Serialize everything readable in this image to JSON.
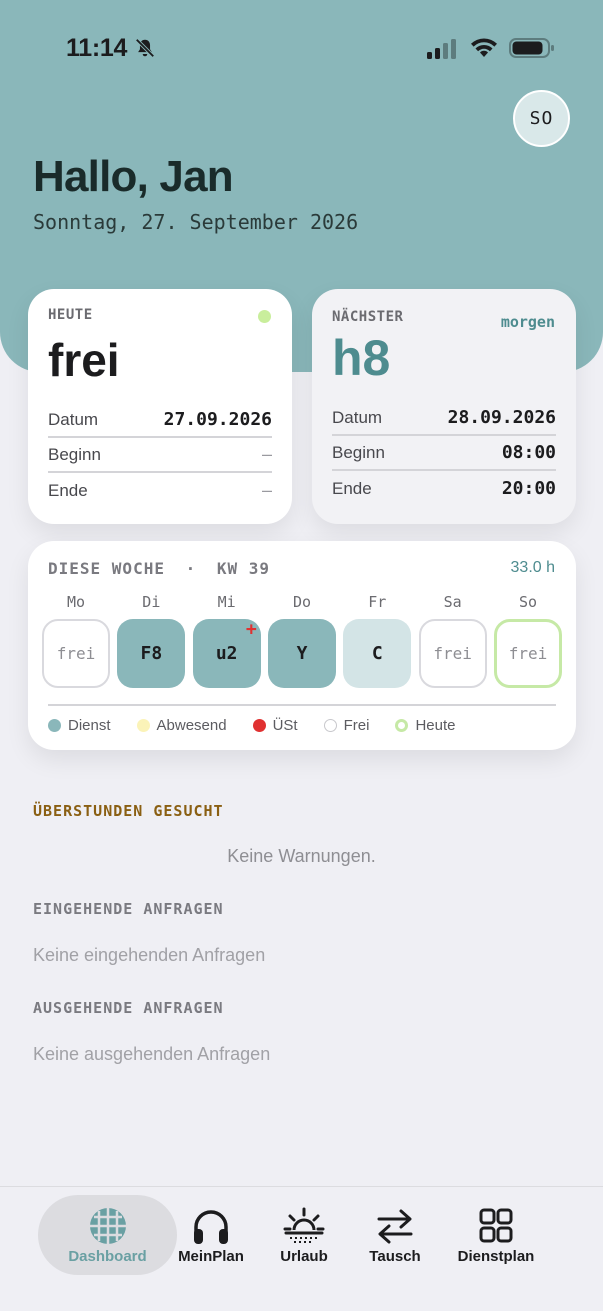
{
  "status_bar": {
    "time": "11:14",
    "icons": [
      "bell-slash-icon",
      "cellular-signal-icon",
      "wifi-icon",
      "battery-icon"
    ]
  },
  "header": {
    "avatar_initials": "SO",
    "greeting": "Hallo, Jan",
    "date": "Sonntag, 27. September 2026"
  },
  "today_card": {
    "label": "HEUTE",
    "value": "frei",
    "rows": [
      {
        "label": "Datum",
        "value": "27.09.2026"
      },
      {
        "label": "Beginn",
        "value": "–"
      },
      {
        "label": "Ende",
        "value": "–"
      }
    ]
  },
  "next_card": {
    "label": "NÄCHSTER",
    "when": "morgen",
    "value": "h8",
    "rows": [
      {
        "label": "Datum",
        "value": "28.09.2026"
      },
      {
        "label": "Beginn",
        "value": "08:00"
      },
      {
        "label": "Ende",
        "value": "20:00"
      }
    ]
  },
  "week": {
    "title": "DIESE WOCHE",
    "separator": "·",
    "kw": "KW 39",
    "hours": "33.0 h",
    "days": [
      {
        "label": "Mo",
        "value": "frei",
        "type": "frei"
      },
      {
        "label": "Di",
        "value": "F8",
        "type": "dienst"
      },
      {
        "label": "Mi",
        "value": "u2",
        "type": "dienst",
        "overtime": "+"
      },
      {
        "label": "Do",
        "value": "Y",
        "type": "dienst"
      },
      {
        "label": "Fr",
        "value": "C",
        "type": "light"
      },
      {
        "label": "Sa",
        "value": "frei",
        "type": "frei"
      },
      {
        "label": "So",
        "value": "frei",
        "type": "heute"
      }
    ],
    "legend": [
      {
        "label": "Dienst",
        "color": "#8ab7ba"
      },
      {
        "label": "Abwesend",
        "color": "#fbf3b8"
      },
      {
        "label": "ÜSt",
        "color": "#e03131"
      },
      {
        "label": "Frei",
        "color": "#ffffff"
      },
      {
        "label": "Heute",
        "color": "#c6e9a6"
      }
    ]
  },
  "sections": {
    "overtime_title": "ÜBERSTUNDEN GESUCHT",
    "overtime_empty": "Keine Warnungen.",
    "incoming_title": "EINGEHENDE ANFRAGEN",
    "incoming_empty": "Keine eingehenden Anfragen",
    "outgoing_title": "AUSGEHENDE ANFRAGEN",
    "outgoing_empty": "Keine ausgehenden Anfragen"
  },
  "tabbar": {
    "tabs": [
      {
        "label": "Dashboard",
        "icon": "globe-grid-icon",
        "active": true
      },
      {
        "label": "MeinPlan",
        "icon": "headphones-icon"
      },
      {
        "label": "Urlaub",
        "icon": "sunrise-icon"
      },
      {
        "label": "Tausch",
        "icon": "swap-arrows-icon"
      },
      {
        "label": "Dienstplan",
        "icon": "grid-icon"
      }
    ]
  },
  "colors": {
    "hero": "#8ab7ba",
    "accent": "#4e8c8f",
    "warning_title": "#8a5f12"
  }
}
